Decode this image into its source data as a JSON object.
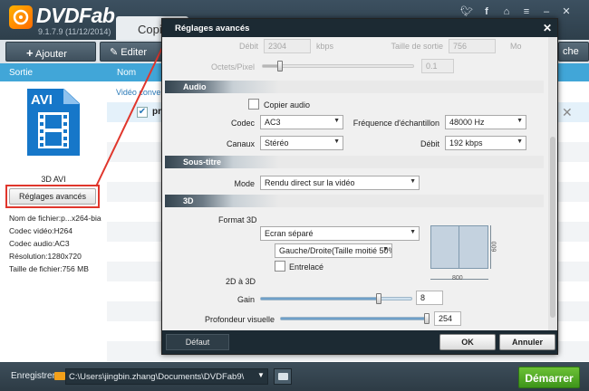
{
  "app": {
    "name": "DVDFab",
    "version": "9.1.7.9 (11/12/2014)",
    "tab": "Copier"
  },
  "titlebar_icons": [
    "twitter-icon",
    "facebook-icon",
    "home-icon",
    "menu-icon",
    "minimize-icon",
    "close-icon"
  ],
  "toolbar": {
    "add_label": "Ajouter",
    "edit_label": "Editer",
    "right_label": "che"
  },
  "left": {
    "header": "Sortie",
    "format_badge": "AVI",
    "format_name": "3D AVI",
    "advanced_button": "Réglages avancés",
    "info": [
      "Nom de fichier:p...x264-bia",
      "Codec vidéo:H264",
      "Codec audio:AC3",
      "Résolution:1280x720",
      "Taille de fichier:756 MB"
    ]
  },
  "center": {
    "header": "Nom",
    "video_title": "Vidéo converte",
    "row_text": "pris"
  },
  "bottom": {
    "save_label": "Enregistrer:",
    "path": "C:\\Users\\jingbin.zhang\\Documents\\DVDFab9\\",
    "start": "Démarrer"
  },
  "dialog": {
    "title": "Réglages avancés",
    "top": {
      "debit_label": "Débit",
      "debit_value": "2304",
      "debit_unit": "kbps",
      "size_label": "Taille de sortie",
      "size_value": "756",
      "size_unit": "Mo",
      "octets_label": "Octets/Pixel",
      "octets_value": "0.1",
      "octets_fraction": 0.12
    },
    "audio": {
      "section": "Audio",
      "copy_label": "Copier audio",
      "codec_label": "Codec",
      "codec_value": "AC3",
      "freq_label": "Fréquence d'échantillon",
      "freq_value": "48000 Hz",
      "channels_label": "Canaux",
      "channels_value": "Stéréo",
      "debit_label": "Débit",
      "debit_value": "192 kbps"
    },
    "subtitle": {
      "section": "Sous-titre",
      "mode_label": "Mode",
      "mode_value": "Rendu direct sur la vidéo"
    },
    "three_d": {
      "section": "3D",
      "format_label": "Format 3D",
      "format_value": "Ecran séparé",
      "layout_value": "Gauche/Droite(Taille moitié 50%",
      "interlace_label": "Entrelacé",
      "preview_w": "800",
      "preview_h": "600",
      "conv_label": "2D à 3D",
      "gain_label": "Gain",
      "gain_value": "8",
      "gain_fraction": 0.78,
      "depth_label": "Profondeur visuelle",
      "depth_value": "254",
      "depth_fraction": 1.0
    },
    "footer": {
      "default": "Défaut",
      "ok": "OK",
      "cancel": "Annuler"
    }
  }
}
